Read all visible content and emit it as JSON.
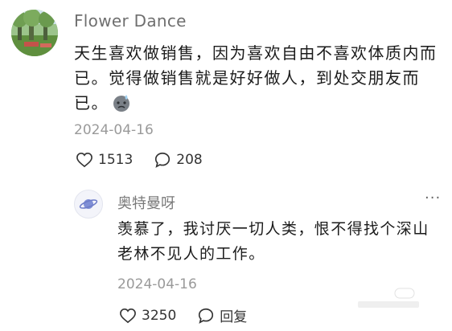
{
  "comment": {
    "author": "Flower Dance",
    "text": "天生喜欢做销售，因为喜欢自由不喜欢体质内而已。觉得做销售就是好好做人，到处交朋友而已。",
    "date": "2024-04-16",
    "likes": "1513",
    "replies": "208"
  },
  "reply": {
    "author": "奥特曼呀",
    "text": "羡慕了，我讨厌一切人类，恨不得找个深山老林不见人的工作。",
    "date": "2024-04-16",
    "likes": "3250",
    "reply_label": "回复",
    "more": "···"
  },
  "icons": {
    "like": "heart-outline-icon",
    "comment": "speech-bubble-icon",
    "emoji": "sweat-face-emoji-icon",
    "avatar_reply": "planet-icon"
  }
}
